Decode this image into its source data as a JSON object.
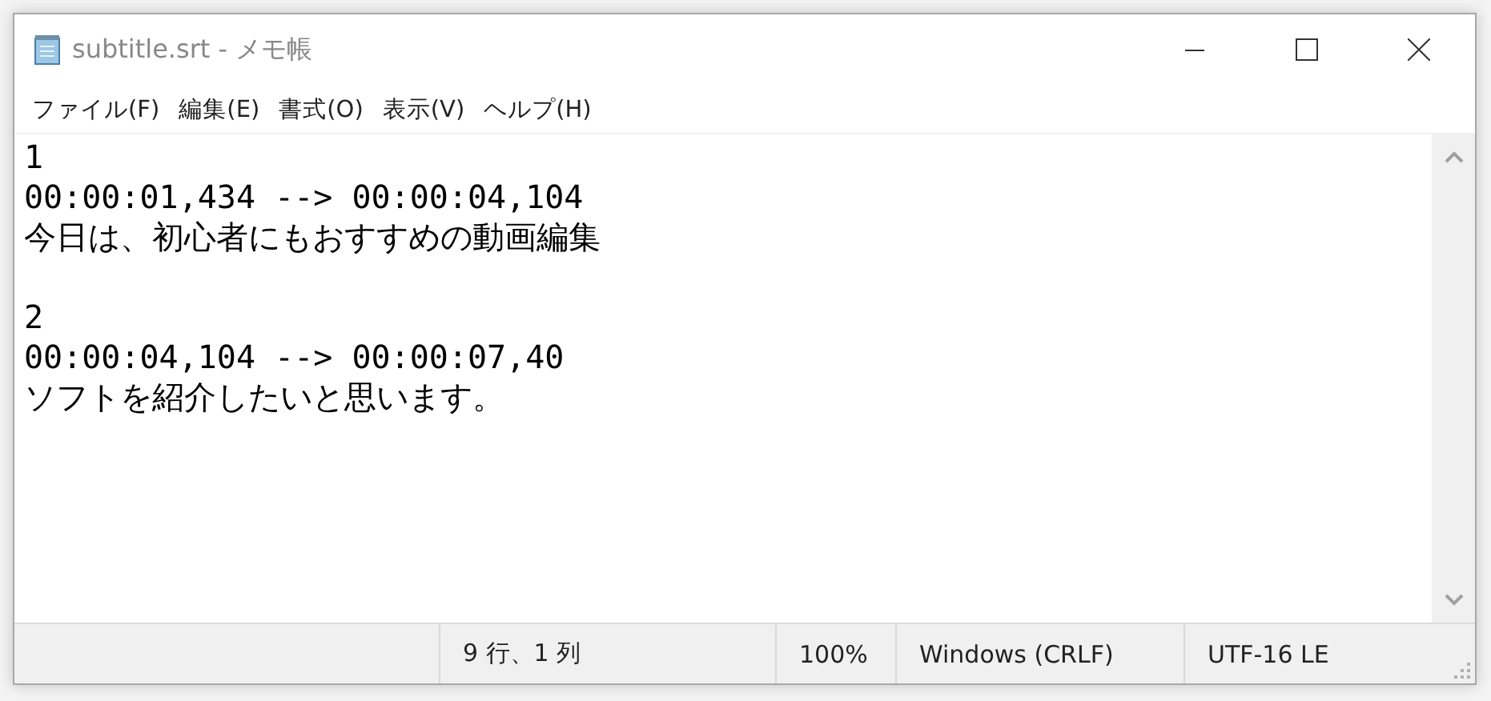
{
  "window": {
    "title": "subtitle.srt - メモ帳"
  },
  "menu": [
    "ファイル(F)",
    "編集(E)",
    "書式(O)",
    "表示(V)",
    "ヘルプ(H)"
  ],
  "cues": [
    {
      "number": "1",
      "timing": "00:00:01,434 --> 00:00:04,104",
      "text": "今日は、初心者にもおすすめの動画編集"
    },
    {
      "number": "2",
      "timing": "00:00:04,104 --> 00:00:07,40",
      "text": "ソフトを紹介したいと思います。"
    }
  ],
  "status_bar": {
    "position": "9 行、1 列",
    "zoom": "100%",
    "line_ending": "Windows (CRLF)",
    "encoding": "UTF-16 LE"
  }
}
